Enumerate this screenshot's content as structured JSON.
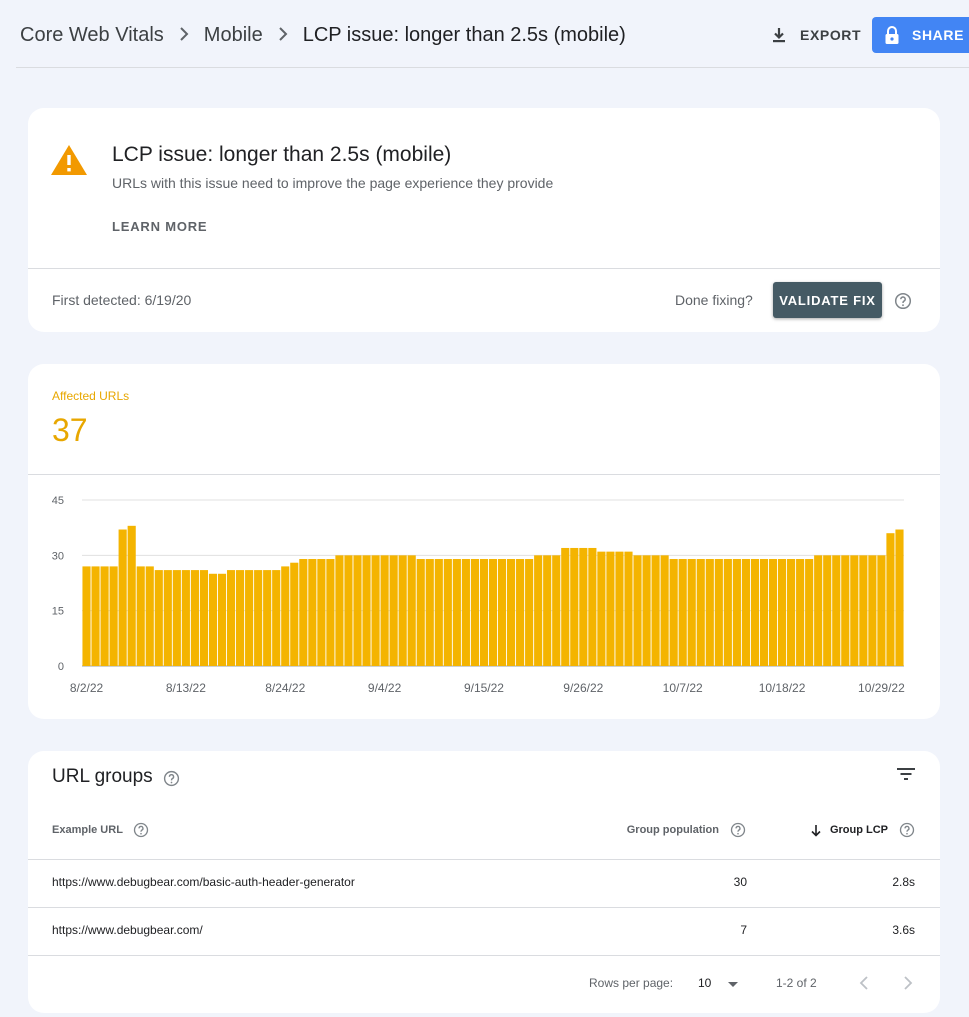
{
  "header": {
    "breadcrumbs": [
      "Core Web Vitals",
      "Mobile",
      "LCP issue: longer than 2.5s (mobile)"
    ],
    "export_label": "EXPORT",
    "share_label": "SHARE"
  },
  "issue": {
    "title": "LCP issue: longer than 2.5s (mobile)",
    "subtitle": "URLs with this issue need to improve the page experience they provide",
    "learn_more": "LEARN MORE",
    "first_detected": "First detected: 6/19/20",
    "done_fixing": "Done fixing?",
    "validate_label": "VALIDATE FIX"
  },
  "summary": {
    "label": "Affected URLs",
    "value": "37"
  },
  "chart_data": {
    "type": "bar",
    "title": "",
    "xlabel": "",
    "ylabel": "",
    "ylim": [
      0,
      45
    ],
    "yticks": [
      0,
      15,
      30,
      45
    ],
    "x_tick_labels": [
      "8/2/22",
      "8/13/22",
      "8/24/22",
      "9/4/22",
      "9/15/22",
      "9/26/22",
      "10/7/22",
      "10/18/22",
      "10/29/22"
    ],
    "x_start": "8/2/22",
    "x_end": "10/30/22",
    "values": [
      27,
      27,
      27,
      27,
      37,
      38,
      27,
      27,
      26,
      26,
      26,
      26,
      26,
      26,
      25,
      25,
      26,
      26,
      26,
      26,
      26,
      26,
      27,
      28,
      29,
      29,
      29,
      29,
      30,
      30,
      30,
      30,
      30,
      30,
      30,
      30,
      30,
      29,
      29,
      29,
      29,
      29,
      29,
      29,
      29,
      29,
      29,
      29,
      29,
      29,
      30,
      30,
      30,
      32,
      32,
      32,
      32,
      31,
      31,
      31,
      31,
      30,
      30,
      30,
      30,
      29,
      29,
      29,
      29,
      29,
      29,
      29,
      29,
      29,
      29,
      29,
      29,
      29,
      29,
      29,
      29,
      30,
      30,
      30,
      30,
      30,
      30,
      30,
      30,
      36,
      37
    ],
    "bar_color": "#f4b400",
    "grid": true
  },
  "url_groups": {
    "title": "URL groups",
    "columns": {
      "example_url": "Example URL",
      "group_population": "Group population",
      "group_lcp": "Group LCP"
    },
    "rows": [
      {
        "url": "https://www.debugbear.com/basic-auth-header-generator",
        "population": "30",
        "lcp": "2.8s"
      },
      {
        "url": "https://www.debugbear.com/",
        "population": "7",
        "lcp": "3.6s"
      }
    ],
    "rows_per_page_label": "Rows per page:",
    "rows_per_page_value": "10",
    "range_label": "1-2 of 2"
  }
}
